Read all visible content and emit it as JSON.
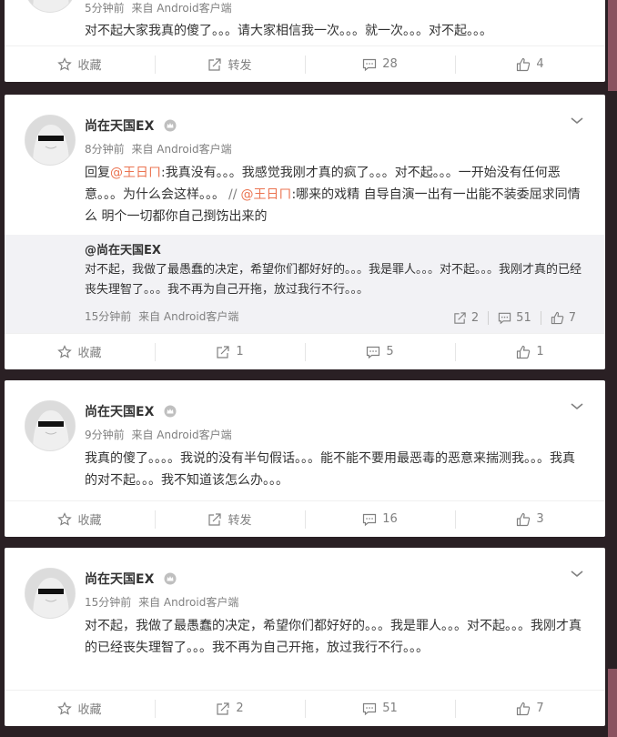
{
  "posts": [
    {
      "time": "5分钟前",
      "source": "来自 Android客户端",
      "text": "对不起大家我真的傻了。。。请大家相信我一次。。。就一次。。。对不起。。。",
      "actions": {
        "collect": "收藏",
        "repost": "转发",
        "comments": "28",
        "likes": "4"
      }
    },
    {
      "username": "尚在天国EX",
      "time": "8分钟前",
      "source": "来自 Android客户端",
      "text_parts": {
        "reply_prefix": "回复",
        "mention1": "@王日ㄇ",
        "text1": ":我真没有。。。我感觉我刚才真的疯了。。。对不起。。。一开始没有任何恶意。。。为什么会这样。。。",
        "separator": "//",
        "mention2": "@王日ㄇ",
        "text2": ":哪来的戏精 自导自演一出有一出能不装委屈求同情么 明个一切都你自己捯饬出来的"
      },
      "repost": {
        "username": "@尚在天国EX",
        "text": "对不起，我做了最愚蠢的决定，希望你们都好好的。。。我是罪人。。。对不起。。。我刚才真的已经丧失理智了。。。我不再为自己开拖，放过我行不行。。。",
        "time": "15分钟前",
        "source": "来自 Android客户端",
        "reposts": "2",
        "comments": "51",
        "likes": "7"
      },
      "actions": {
        "collect": "收藏",
        "repost": "1",
        "comments": "5",
        "likes": "1"
      }
    },
    {
      "username": "尚在天国EX",
      "time": "9分钟前",
      "source": "来自 Android客户端",
      "text": "我真的傻了。。。。我说的没有半句假话。。。能不能不要用最恶毒的恶意来揣测我。。。我真的对不起。。。我不知道该怎么办。。。",
      "actions": {
        "collect": "收藏",
        "repost": "转发",
        "comments": "16",
        "likes": "3"
      }
    },
    {
      "username": "尚在天国EX",
      "time": "15分钟前",
      "source": "来自 Android客户端",
      "text": "对不起，我做了最愚蠢的决定，希望你们都好好的。。。我是罪人。。。对不起。。。我刚才真的已经丧失理智了。。。我不再为自己开拖，放过我行不行。。。",
      "actions": {
        "collect": "收藏",
        "repost": "2",
        "comments": "51",
        "likes": "7"
      }
    }
  ],
  "colors": {
    "mention": "#eb7350",
    "meta": "#808080",
    "background": "#2a2024"
  }
}
